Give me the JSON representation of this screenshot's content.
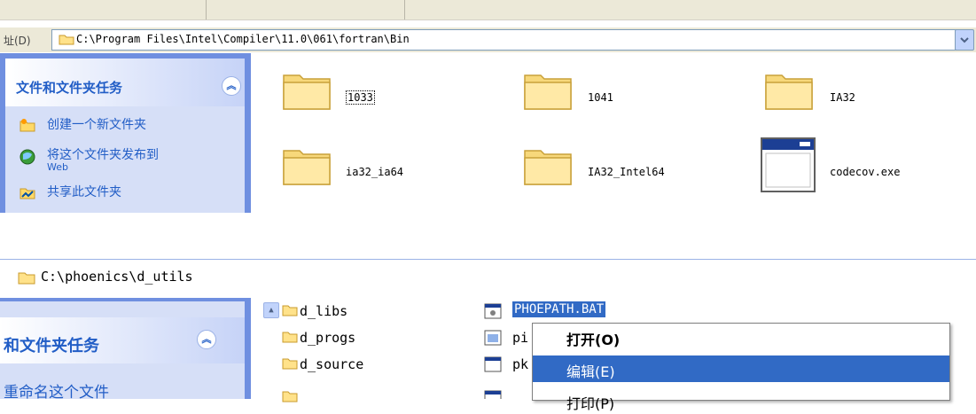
{
  "address_bar": {
    "label": "址(D)",
    "path": "C:\\Program Files\\Intel\\Compiler\\11.0\\061\\fortran\\Bin"
  },
  "task_pane": {
    "title": "文件和文件夹任务",
    "links": [
      "创建一个新文件夹",
      "将这个文件夹发布到",
      "Web",
      "共享此文件夹"
    ]
  },
  "files": [
    {
      "name": "1033",
      "type": "folder"
    },
    {
      "name": "1041",
      "type": "folder"
    },
    {
      "name": "IA32",
      "type": "folder"
    },
    {
      "name": "ia32_ia64",
      "type": "folder"
    },
    {
      "name": "IA32_Intel64",
      "type": "folder"
    },
    {
      "name": "codecov.exe",
      "type": "exe"
    }
  ],
  "second_window": {
    "path": "C:\\phoenics\\d_utils",
    "pane_title": "和文件夹任务",
    "pane_link": "重命名这个文件",
    "folders": [
      "d_libs",
      "d_progs",
      "d_source"
    ],
    "files": [
      "PHOEPATH.BAT",
      "pi",
      "pk"
    ]
  },
  "context_menu": {
    "items": [
      "打开(O)",
      "编辑(E)",
      "打印(P)"
    ],
    "highlight_color": "#316ac5"
  }
}
